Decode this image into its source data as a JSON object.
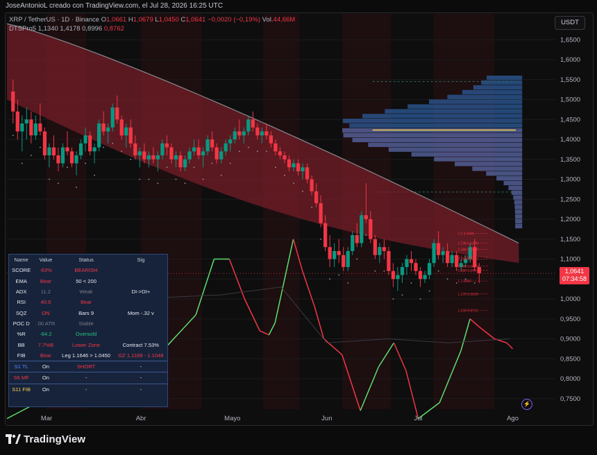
{
  "header": {
    "credit": "JoseAntonioL creado con TradingView.com, el Jul 28, 2026 16:25 UTC"
  },
  "legend": {
    "symbol": "XRP / TetherUS · 1D · Binance",
    "open_label": "O",
    "open": "1,0661",
    "high_label": "H",
    "high": "1,0679",
    "low_label": "L",
    "low": "1,0450",
    "close_label": "C",
    "close": "1,0641",
    "change": "−0,0020 (−0,19%)",
    "vol_label": "Vol.",
    "vol": "44,66M",
    "indicator": "DTSPro5",
    "ind_v1": "1,1340",
    "ind_v2": "1,4178",
    "ind_v3": "0,8996",
    "ind_v4": "0,8762"
  },
  "currency_button": "USDT",
  "price_tag": {
    "price": "1,0641",
    "countdown": "07:34:58"
  },
  "colors": {
    "up": "#089981",
    "down": "#f23645",
    "band": "#7a1e2a",
    "profile": "#3f6fb0",
    "poc": "#f5d34b"
  },
  "chart_data": {
    "type": "candlestick",
    "title": "XRP / TetherUS · 1D · Binance",
    "y_ticks": [
      "1,6500",
      "1,6000",
      "1,5500",
      "1,5000",
      "1,4500",
      "1,4000",
      "1,3500",
      "1,3000",
      "1,2500",
      "1,2000",
      "1,1500",
      "1,1000",
      "1,0500",
      "1,0000",
      "0,9500",
      "0,9000",
      "0,8500",
      "0,8000",
      "0,7500"
    ],
    "y_tick_values": [
      1.65,
      1.6,
      1.55,
      1.5,
      1.45,
      1.4,
      1.35,
      1.3,
      1.25,
      1.2,
      1.15,
      1.1,
      1.05,
      1.0,
      0.95,
      0.9,
      0.85,
      0.8,
      0.75
    ],
    "ylim": [
      0.72,
      1.68
    ],
    "x_ticks": [
      "Mar",
      "Abr",
      "Mayo",
      "Jun",
      "Jul",
      "Ago"
    ],
    "x_tick_days": [
      13,
      44,
      74,
      105,
      135,
      166
    ],
    "xlim": [
      0,
      180
    ],
    "current_price": 1.0641,
    "poc_level": 1.4235,
    "fib_labels": [
      "0.0 1.1646",
      "0.236 1.1399",
      "0.382 1.1246",
      "0.5 1.1048",
      "0.618 1.0997",
      "0.786 1.0821",
      "0.886 1.0717",
      "1 1.0450",
      "1.272 1.0125",
      "1.618 0.9711"
    ],
    "fib_levels": [
      1.1646,
      1.1399,
      1.1246,
      1.1048,
      1.0997,
      1.0821,
      1.0717,
      1.045,
      1.0125,
      0.9711
    ],
    "ohlc": [
      [
        1.52,
        1.55,
        1.44,
        1.47
      ],
      [
        1.47,
        1.5,
        1.4,
        1.42
      ],
      [
        1.42,
        1.46,
        1.37,
        1.44
      ],
      [
        1.44,
        1.48,
        1.4,
        1.45
      ],
      [
        1.45,
        1.47,
        1.39,
        1.41
      ],
      [
        1.41,
        1.46,
        1.4,
        1.44
      ],
      [
        1.44,
        1.49,
        1.41,
        1.42
      ],
      [
        1.42,
        1.43,
        1.35,
        1.36
      ],
      [
        1.36,
        1.39,
        1.33,
        1.38
      ],
      [
        1.38,
        1.41,
        1.35,
        1.36
      ],
      [
        1.36,
        1.38,
        1.32,
        1.34
      ],
      [
        1.34,
        1.39,
        1.33,
        1.38
      ],
      [
        1.38,
        1.42,
        1.36,
        1.37
      ],
      [
        1.37,
        1.38,
        1.33,
        1.34
      ],
      [
        1.34,
        1.37,
        1.31,
        1.36
      ],
      [
        1.36,
        1.4,
        1.35,
        1.39
      ],
      [
        1.39,
        1.43,
        1.37,
        1.41
      ],
      [
        1.41,
        1.42,
        1.36,
        1.37
      ],
      [
        1.37,
        1.39,
        1.34,
        1.38
      ],
      [
        1.38,
        1.45,
        1.37,
        1.44
      ],
      [
        1.44,
        1.47,
        1.41,
        1.42
      ],
      [
        1.42,
        1.44,
        1.39,
        1.43
      ],
      [
        1.43,
        1.49,
        1.42,
        1.48
      ],
      [
        1.48,
        1.51,
        1.44,
        1.45
      ],
      [
        1.45,
        1.46,
        1.4,
        1.41
      ],
      [
        1.41,
        1.44,
        1.38,
        1.43
      ],
      [
        1.43,
        1.45,
        1.38,
        1.39
      ],
      [
        1.39,
        1.41,
        1.35,
        1.36
      ],
      [
        1.36,
        1.38,
        1.33,
        1.37
      ],
      [
        1.37,
        1.39,
        1.34,
        1.35
      ],
      [
        1.35,
        1.37,
        1.33,
        1.36
      ],
      [
        1.36,
        1.38,
        1.34,
        1.35
      ],
      [
        1.35,
        1.37,
        1.32,
        1.36
      ],
      [
        1.36,
        1.4,
        1.35,
        1.39
      ],
      [
        1.39,
        1.41,
        1.36,
        1.38
      ],
      [
        1.38,
        1.39,
        1.34,
        1.35
      ],
      [
        1.35,
        1.37,
        1.33,
        1.36
      ],
      [
        1.36,
        1.37,
        1.32,
        1.33
      ],
      [
        1.33,
        1.36,
        1.32,
        1.35
      ],
      [
        1.35,
        1.38,
        1.34,
        1.37
      ],
      [
        1.37,
        1.4,
        1.36,
        1.38
      ],
      [
        1.38,
        1.4,
        1.35,
        1.36
      ],
      [
        1.36,
        1.38,
        1.33,
        1.37
      ],
      [
        1.37,
        1.41,
        1.36,
        1.4
      ],
      [
        1.4,
        1.42,
        1.37,
        1.38
      ],
      [
        1.38,
        1.39,
        1.34,
        1.35
      ],
      [
        1.35,
        1.38,
        1.34,
        1.37
      ],
      [
        1.37,
        1.4,
        1.36,
        1.39
      ],
      [
        1.39,
        1.41,
        1.37,
        1.4
      ],
      [
        1.4,
        1.43,
        1.39,
        1.42
      ],
      [
        1.42,
        1.45,
        1.4,
        1.41
      ],
      [
        1.41,
        1.43,
        1.39,
        1.42
      ],
      [
        1.42,
        1.46,
        1.41,
        1.45
      ],
      [
        1.45,
        1.47,
        1.42,
        1.43
      ],
      [
        1.43,
        1.44,
        1.4,
        1.41
      ],
      [
        1.41,
        1.43,
        1.39,
        1.42
      ],
      [
        1.42,
        1.44,
        1.4,
        1.41
      ],
      [
        1.41,
        1.42,
        1.38,
        1.39
      ],
      [
        1.39,
        1.4,
        1.36,
        1.37
      ],
      [
        1.37,
        1.38,
        1.35,
        1.36
      ],
      [
        1.36,
        1.37,
        1.34,
        1.35
      ],
      [
        1.35,
        1.36,
        1.32,
        1.33
      ],
      [
        1.33,
        1.35,
        1.32,
        1.34
      ],
      [
        1.34,
        1.35,
        1.31,
        1.32
      ],
      [
        1.32,
        1.34,
        1.3,
        1.33
      ],
      [
        1.33,
        1.34,
        1.29,
        1.3
      ],
      [
        1.3,
        1.31,
        1.26,
        1.27
      ],
      [
        1.27,
        1.29,
        1.23,
        1.24
      ],
      [
        1.24,
        1.26,
        1.18,
        1.19
      ],
      [
        1.19,
        1.21,
        1.12,
        1.13
      ],
      [
        1.13,
        1.16,
        1.08,
        1.1
      ],
      [
        1.1,
        1.14,
        1.08,
        1.12
      ],
      [
        1.12,
        1.15,
        1.09,
        1.11
      ],
      [
        1.11,
        1.13,
        1.07,
        1.08
      ],
      [
        1.08,
        1.13,
        1.07,
        1.12
      ],
      [
        1.12,
        1.17,
        1.11,
        1.16
      ],
      [
        1.16,
        1.19,
        1.13,
        1.14
      ],
      [
        1.14,
        1.22,
        1.13,
        1.21
      ],
      [
        1.21,
        1.29,
        1.19,
        1.2
      ],
      [
        1.2,
        1.22,
        1.14,
        1.15
      ],
      [
        1.15,
        1.16,
        1.1,
        1.11
      ],
      [
        1.11,
        1.14,
        1.09,
        1.13
      ],
      [
        1.13,
        1.15,
        1.1,
        1.12
      ],
      [
        1.12,
        1.13,
        1.06,
        1.07
      ],
      [
        1.07,
        1.09,
        1.03,
        1.05
      ],
      [
        1.05,
        1.08,
        1.02,
        1.06
      ],
      [
        1.06,
        1.09,
        1.04,
        1.08
      ],
      [
        1.08,
        1.11,
        1.06,
        1.1
      ],
      [
        1.1,
        1.12,
        1.07,
        1.09
      ],
      [
        1.09,
        1.1,
        1.06,
        1.07
      ],
      [
        1.07,
        1.08,
        1.03,
        1.05
      ],
      [
        1.05,
        1.07,
        1.04,
        1.06
      ],
      [
        1.06,
        1.1,
        1.05,
        1.09
      ],
      [
        1.09,
        1.15,
        1.08,
        1.14
      ],
      [
        1.14,
        1.17,
        1.1,
        1.11
      ],
      [
        1.11,
        1.13,
        1.09,
        1.12
      ],
      [
        1.12,
        1.14,
        1.08,
        1.09
      ],
      [
        1.09,
        1.12,
        1.08,
        1.11
      ],
      [
        1.11,
        1.12,
        1.07,
        1.08
      ],
      [
        1.08,
        1.1,
        1.07,
        1.09
      ],
      [
        1.09,
        1.11,
        1.08,
        1.1
      ],
      [
        1.1,
        1.14,
        1.09,
        1.13
      ],
      [
        1.13,
        1.15,
        1.07,
        1.08
      ],
      [
        1.08,
        1.09,
        1.04,
        1.0641
      ]
    ]
  },
  "table": {
    "headers": [
      "Name",
      "Value",
      "Status",
      "Sig"
    ],
    "rows": [
      [
        "SCORE",
        "-63%",
        "BEARISH",
        ""
      ],
      [
        "EMA",
        "Bear",
        "50 < 200",
        ""
      ],
      [
        "ADX",
        "11.2",
        "Weak",
        "DI->DI+"
      ],
      [
        "RSI",
        "40.9",
        "Bear",
        ""
      ],
      [
        "SQZ",
        "ON",
        "Bars 9",
        "Mom -.32 v"
      ],
      [
        "POC D",
        ".00 ATR",
        "Stable",
        ""
      ],
      [
        "%R",
        "-84.2",
        "Oversold",
        ""
      ],
      [
        "BB",
        "7.7%B",
        "Lower Zone",
        "Contract 7.53%"
      ],
      [
        "FIB",
        "Bear",
        "Leg 1.1646 > 1.0450",
        "GZ 1.1189 - 1.1048"
      ]
    ],
    "signals": [
      [
        "S1 TL",
        "On",
        "SHORT",
        "-"
      ],
      [
        "S6 MF",
        "On",
        "-",
        "-"
      ],
      [
        "S11 FIB",
        "On",
        "-",
        "-"
      ]
    ]
  },
  "brand": {
    "name": "TradingView"
  }
}
